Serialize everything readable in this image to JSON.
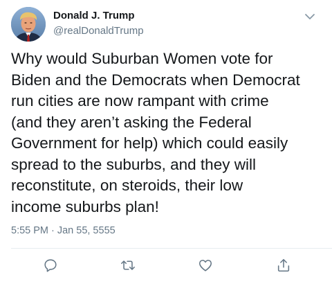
{
  "author": {
    "display_name": "Donald J. Trump",
    "handle": "@realDonaldTrump"
  },
  "tweet": {
    "lines": [
      "Why would Suburban Women vote for",
      "Biden and the Democrats when Democrat",
      "run cities are now rampant with crime",
      "(and they aren’t asking the Federal",
      "Government for help) which could easily",
      "spread to the suburbs, and they will",
      "reconstitute, on steroids, their low",
      "income suburbs plan!"
    ],
    "time": "5:55 PM",
    "separator": "·",
    "date": "Jan 55, 5555"
  },
  "icons": {
    "caret": "chevron-down-icon",
    "reply": "reply-icon",
    "retweet": "retweet-icon",
    "like": "heart-icon",
    "share": "share-icon"
  },
  "colors": {
    "text": "#14171a",
    "secondary": "#657786",
    "divider": "#e6ecf0"
  }
}
